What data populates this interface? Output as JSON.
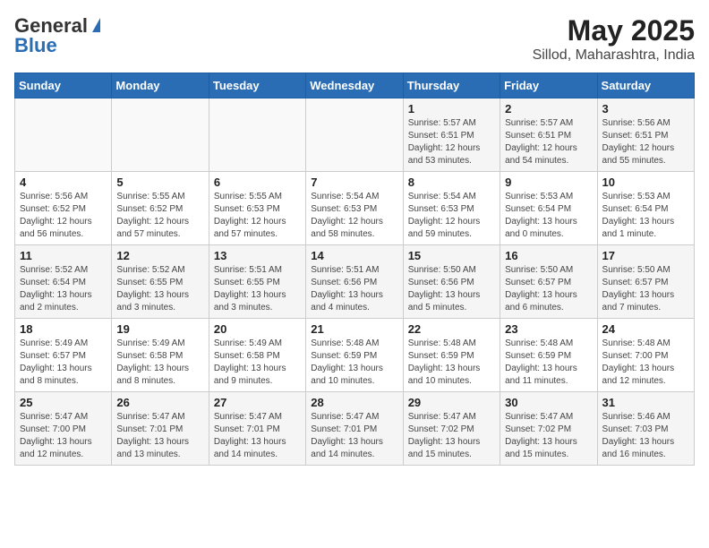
{
  "header": {
    "logo_general": "General",
    "logo_blue": "Blue",
    "title": "May 2025",
    "subtitle": "Sillod, Maharashtra, India"
  },
  "weekdays": [
    "Sunday",
    "Monday",
    "Tuesday",
    "Wednesday",
    "Thursday",
    "Friday",
    "Saturday"
  ],
  "weeks": [
    [
      {
        "day": "",
        "info": ""
      },
      {
        "day": "",
        "info": ""
      },
      {
        "day": "",
        "info": ""
      },
      {
        "day": "",
        "info": ""
      },
      {
        "day": "1",
        "info": "Sunrise: 5:57 AM\nSunset: 6:51 PM\nDaylight: 12 hours\nand 53 minutes."
      },
      {
        "day": "2",
        "info": "Sunrise: 5:57 AM\nSunset: 6:51 PM\nDaylight: 12 hours\nand 54 minutes."
      },
      {
        "day": "3",
        "info": "Sunrise: 5:56 AM\nSunset: 6:51 PM\nDaylight: 12 hours\nand 55 minutes."
      }
    ],
    [
      {
        "day": "4",
        "info": "Sunrise: 5:56 AM\nSunset: 6:52 PM\nDaylight: 12 hours\nand 56 minutes."
      },
      {
        "day": "5",
        "info": "Sunrise: 5:55 AM\nSunset: 6:52 PM\nDaylight: 12 hours\nand 57 minutes."
      },
      {
        "day": "6",
        "info": "Sunrise: 5:55 AM\nSunset: 6:53 PM\nDaylight: 12 hours\nand 57 minutes."
      },
      {
        "day": "7",
        "info": "Sunrise: 5:54 AM\nSunset: 6:53 PM\nDaylight: 12 hours\nand 58 minutes."
      },
      {
        "day": "8",
        "info": "Sunrise: 5:54 AM\nSunset: 6:53 PM\nDaylight: 12 hours\nand 59 minutes."
      },
      {
        "day": "9",
        "info": "Sunrise: 5:53 AM\nSunset: 6:54 PM\nDaylight: 13 hours\nand 0 minutes."
      },
      {
        "day": "10",
        "info": "Sunrise: 5:53 AM\nSunset: 6:54 PM\nDaylight: 13 hours\nand 1 minute."
      }
    ],
    [
      {
        "day": "11",
        "info": "Sunrise: 5:52 AM\nSunset: 6:54 PM\nDaylight: 13 hours\nand 2 minutes."
      },
      {
        "day": "12",
        "info": "Sunrise: 5:52 AM\nSunset: 6:55 PM\nDaylight: 13 hours\nand 3 minutes."
      },
      {
        "day": "13",
        "info": "Sunrise: 5:51 AM\nSunset: 6:55 PM\nDaylight: 13 hours\nand 3 minutes."
      },
      {
        "day": "14",
        "info": "Sunrise: 5:51 AM\nSunset: 6:56 PM\nDaylight: 13 hours\nand 4 minutes."
      },
      {
        "day": "15",
        "info": "Sunrise: 5:50 AM\nSunset: 6:56 PM\nDaylight: 13 hours\nand 5 minutes."
      },
      {
        "day": "16",
        "info": "Sunrise: 5:50 AM\nSunset: 6:57 PM\nDaylight: 13 hours\nand 6 minutes."
      },
      {
        "day": "17",
        "info": "Sunrise: 5:50 AM\nSunset: 6:57 PM\nDaylight: 13 hours\nand 7 minutes."
      }
    ],
    [
      {
        "day": "18",
        "info": "Sunrise: 5:49 AM\nSunset: 6:57 PM\nDaylight: 13 hours\nand 8 minutes."
      },
      {
        "day": "19",
        "info": "Sunrise: 5:49 AM\nSunset: 6:58 PM\nDaylight: 13 hours\nand 8 minutes."
      },
      {
        "day": "20",
        "info": "Sunrise: 5:49 AM\nSunset: 6:58 PM\nDaylight: 13 hours\nand 9 minutes."
      },
      {
        "day": "21",
        "info": "Sunrise: 5:48 AM\nSunset: 6:59 PM\nDaylight: 13 hours\nand 10 minutes."
      },
      {
        "day": "22",
        "info": "Sunrise: 5:48 AM\nSunset: 6:59 PM\nDaylight: 13 hours\nand 10 minutes."
      },
      {
        "day": "23",
        "info": "Sunrise: 5:48 AM\nSunset: 6:59 PM\nDaylight: 13 hours\nand 11 minutes."
      },
      {
        "day": "24",
        "info": "Sunrise: 5:48 AM\nSunset: 7:00 PM\nDaylight: 13 hours\nand 12 minutes."
      }
    ],
    [
      {
        "day": "25",
        "info": "Sunrise: 5:47 AM\nSunset: 7:00 PM\nDaylight: 13 hours\nand 12 minutes."
      },
      {
        "day": "26",
        "info": "Sunrise: 5:47 AM\nSunset: 7:01 PM\nDaylight: 13 hours\nand 13 minutes."
      },
      {
        "day": "27",
        "info": "Sunrise: 5:47 AM\nSunset: 7:01 PM\nDaylight: 13 hours\nand 14 minutes."
      },
      {
        "day": "28",
        "info": "Sunrise: 5:47 AM\nSunset: 7:01 PM\nDaylight: 13 hours\nand 14 minutes."
      },
      {
        "day": "29",
        "info": "Sunrise: 5:47 AM\nSunset: 7:02 PM\nDaylight: 13 hours\nand 15 minutes."
      },
      {
        "day": "30",
        "info": "Sunrise: 5:47 AM\nSunset: 7:02 PM\nDaylight: 13 hours\nand 15 minutes."
      },
      {
        "day": "31",
        "info": "Sunrise: 5:46 AM\nSunset: 7:03 PM\nDaylight: 13 hours\nand 16 minutes."
      }
    ]
  ]
}
